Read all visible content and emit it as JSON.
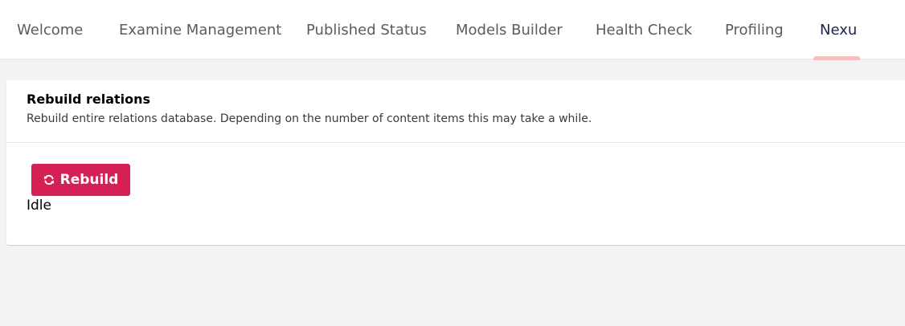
{
  "tabs": [
    {
      "label": "Welcome",
      "active": false
    },
    {
      "label": "Examine Management",
      "active": false
    },
    {
      "label": "Published Status",
      "active": false
    },
    {
      "label": "Models Builder",
      "active": false
    },
    {
      "label": "Health Check",
      "active": false
    },
    {
      "label": "Profiling",
      "active": false
    },
    {
      "label": "Nexu",
      "active": true
    }
  ],
  "card": {
    "title": "Rebuild relations",
    "description": "Rebuild entire relations database. Depending on the number of content items this may take a while.",
    "button_label": "Rebuild",
    "button_icon": "sync-icon",
    "status": "Idle"
  },
  "colors": {
    "accent": "#d42054",
    "active_tab_indicator": "#f5c1bc",
    "background": "#f4f2f2"
  }
}
